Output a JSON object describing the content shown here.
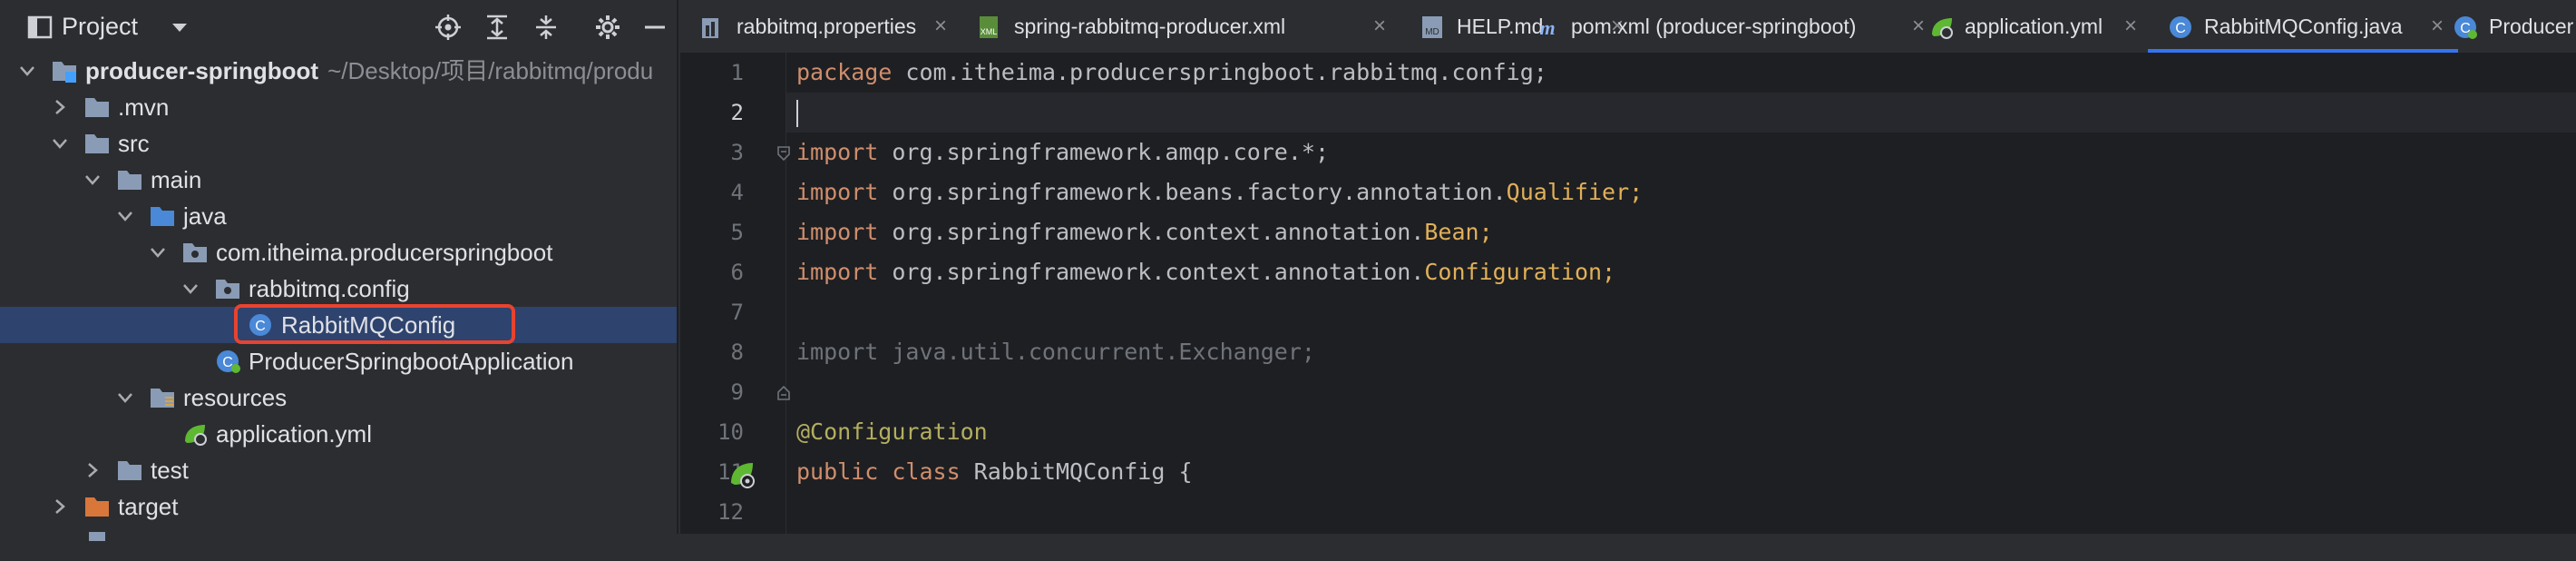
{
  "panel": {
    "title": "Project",
    "tree": [
      {
        "label": "producer-springboot",
        "path": "~/Desktop/项目/rabbitmq/produ",
        "icon": "module-folder-icon"
      },
      {
        "label": ".mvn",
        "icon": "folder-icon"
      },
      {
        "label": "src",
        "icon": "folder-icon"
      },
      {
        "label": "main",
        "icon": "folder-icon"
      },
      {
        "label": "java",
        "icon": "source-folder-icon"
      },
      {
        "label": "com.itheima.producerspringboot",
        "icon": "package-icon"
      },
      {
        "label": "rabbitmq.config",
        "icon": "package-icon"
      },
      {
        "label": "RabbitMQConfig",
        "icon": "java-class-icon"
      },
      {
        "label": "ProducerSpringbootApplication",
        "icon": "spring-boot-class-icon"
      },
      {
        "label": "resources",
        "icon": "resources-folder-icon"
      },
      {
        "label": "application.yml",
        "icon": "spring-yaml-icon"
      },
      {
        "label": "test",
        "icon": "folder-icon"
      },
      {
        "label": "target",
        "icon": "excluded-folder-icon"
      }
    ]
  },
  "tabs": [
    {
      "label": "rabbitmq.properties",
      "icon": "properties-file-icon"
    },
    {
      "label": "spring-rabbitmq-producer.xml",
      "icon": "spring-xml-icon"
    },
    {
      "label": "HELP.md",
      "icon": "markdown-file-icon"
    },
    {
      "label": "pom.xml (producer-springboot)",
      "icon": "maven-icon"
    },
    {
      "label": "application.yml",
      "icon": "spring-yaml-icon"
    },
    {
      "label": "RabbitMQConfig.java",
      "icon": "java-class-icon"
    },
    {
      "label": "Producer",
      "icon": "spring-boot-class-icon"
    }
  ],
  "close_glyph": "×",
  "line_numbers": [
    "1",
    "2",
    "3",
    "4",
    "5",
    "6",
    "7",
    "8",
    "9",
    "10",
    "11",
    "12"
  ],
  "code": {
    "l1_kw": "package",
    "l1_rest": " com.itheima.producerspringboot.rabbitmq.config;",
    "import_kw": "import",
    "l3_rest": " org.springframework.amqp.core.*;",
    "l4_rest": " org.springframework.beans.factory.annotation.",
    "l4_cls": "Qualifier",
    "l4_end": ";",
    "l5_rest": " org.springframework.context.annotation.",
    "l5_cls": "Bean",
    "l5_end": ";",
    "l6_rest": " org.springframework.context.annotation.",
    "l6_cls": "Configuration",
    "l6_end": ";",
    "l8": "import java.util.concurrent.Exchanger;",
    "l10": "@Configuration",
    "l11_kw": "public class",
    "l11_rest": " RabbitMQConfig {"
  },
  "colors": {
    "accent": "#3574f0",
    "highlight": "#e8432f",
    "keyword": "#cf8e6d",
    "annotation": "#b3ae60"
  }
}
